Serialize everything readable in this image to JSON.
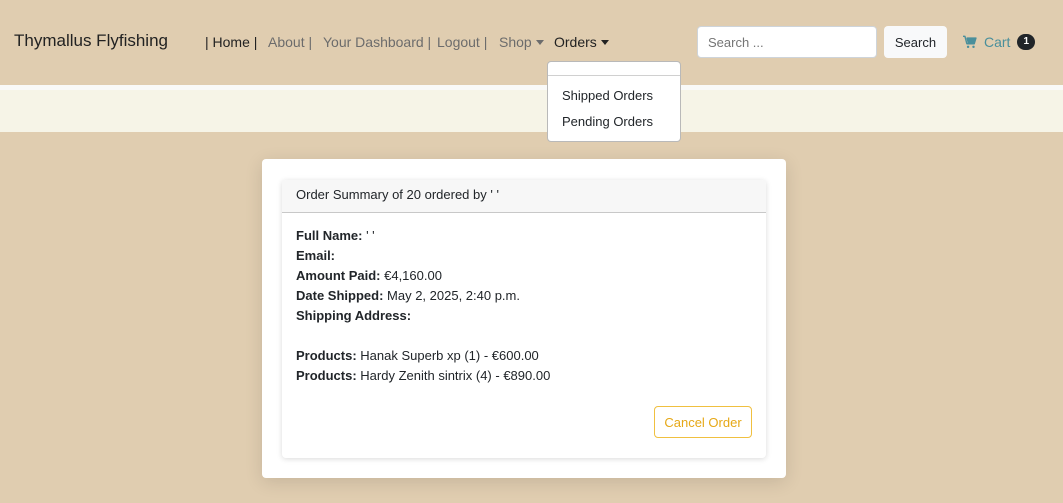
{
  "navbar": {
    "brand": "Thymallus Flyfishing",
    "links": {
      "home": "| Home |",
      "about": "About |",
      "dashboard": "Your Dashboard |",
      "logout": "Logout |",
      "shop": "Shop",
      "orders": "Orders"
    },
    "search": {
      "placeholder": "Search ...",
      "button_label": "Search"
    },
    "cart": {
      "label": "Cart",
      "count": "1",
      "icon": "cart-icon"
    }
  },
  "orders_dropdown": {
    "items": [
      "Shipped Orders",
      "Pending Orders"
    ]
  },
  "order": {
    "header": "Order Summary of 20 ordered by ' '",
    "full_name_label": "Full Name:",
    "full_name_value": " ' '",
    "email_label": "Email:",
    "email_value": "",
    "amount_label": "Amount Paid:",
    "amount_value": " €4,160.00",
    "date_label": "Date Shipped:",
    "date_value": " May 2, 2025, 2:40 p.m.",
    "address_label": "Shipping Address:",
    "address_value": "",
    "products": [
      {
        "label": "Products:",
        "value": " Hanak Superb xp (1) - €600.00"
      },
      {
        "label": "Products:",
        "value": " Hardy Zenith sintrix (4) - €890.00"
      }
    ],
    "cancel_label": "Cancel Order"
  },
  "colors": {
    "background": "#e0cdb0",
    "subbar": "#f6f4e7",
    "cart_link": "#4a8f9b",
    "cancel_button": "#e6a817"
  }
}
